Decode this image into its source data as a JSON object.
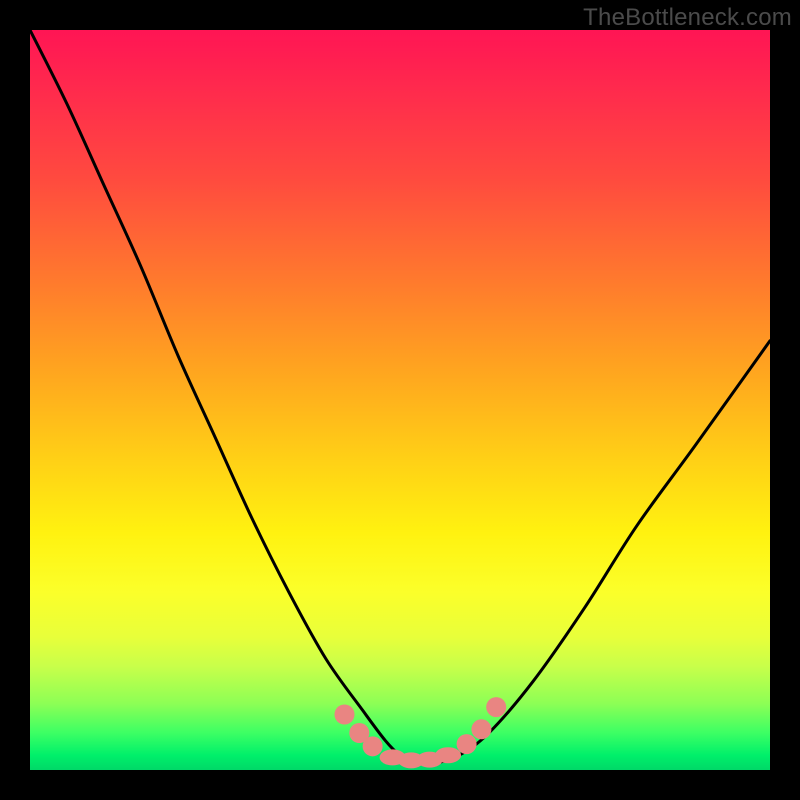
{
  "watermark": "TheBottleneck.com",
  "chart_data": {
    "type": "line",
    "title": "",
    "xlabel": "",
    "ylabel": "",
    "xlim": [
      0,
      100
    ],
    "ylim": [
      0,
      100
    ],
    "grid": false,
    "series": [
      {
        "name": "bottleneck-curve",
        "x": [
          0,
          5,
          10,
          15,
          20,
          25,
          30,
          35,
          40,
          45,
          48,
          50,
          52,
          55,
          58,
          62,
          68,
          75,
          82,
          90,
          100
        ],
        "values": [
          100,
          90,
          79,
          68,
          56,
          45,
          34,
          24,
          15,
          8,
          4,
          2,
          1,
          1,
          2,
          5,
          12,
          22,
          33,
          44,
          58
        ]
      }
    ],
    "markers": [
      {
        "x": 42.5,
        "y": 7.5
      },
      {
        "x": 44.5,
        "y": 5.0
      },
      {
        "x": 46.3,
        "y": 3.2
      },
      {
        "x": 49.0,
        "y": 1.7
      },
      {
        "x": 51.5,
        "y": 1.3
      },
      {
        "x": 54.0,
        "y": 1.4
      },
      {
        "x": 56.5,
        "y": 2.0
      },
      {
        "x": 59.0,
        "y": 3.5
      },
      {
        "x": 61.0,
        "y": 5.5
      },
      {
        "x": 63.0,
        "y": 8.5
      }
    ],
    "marker_color": "#e98582",
    "curve_color": "#000000"
  }
}
